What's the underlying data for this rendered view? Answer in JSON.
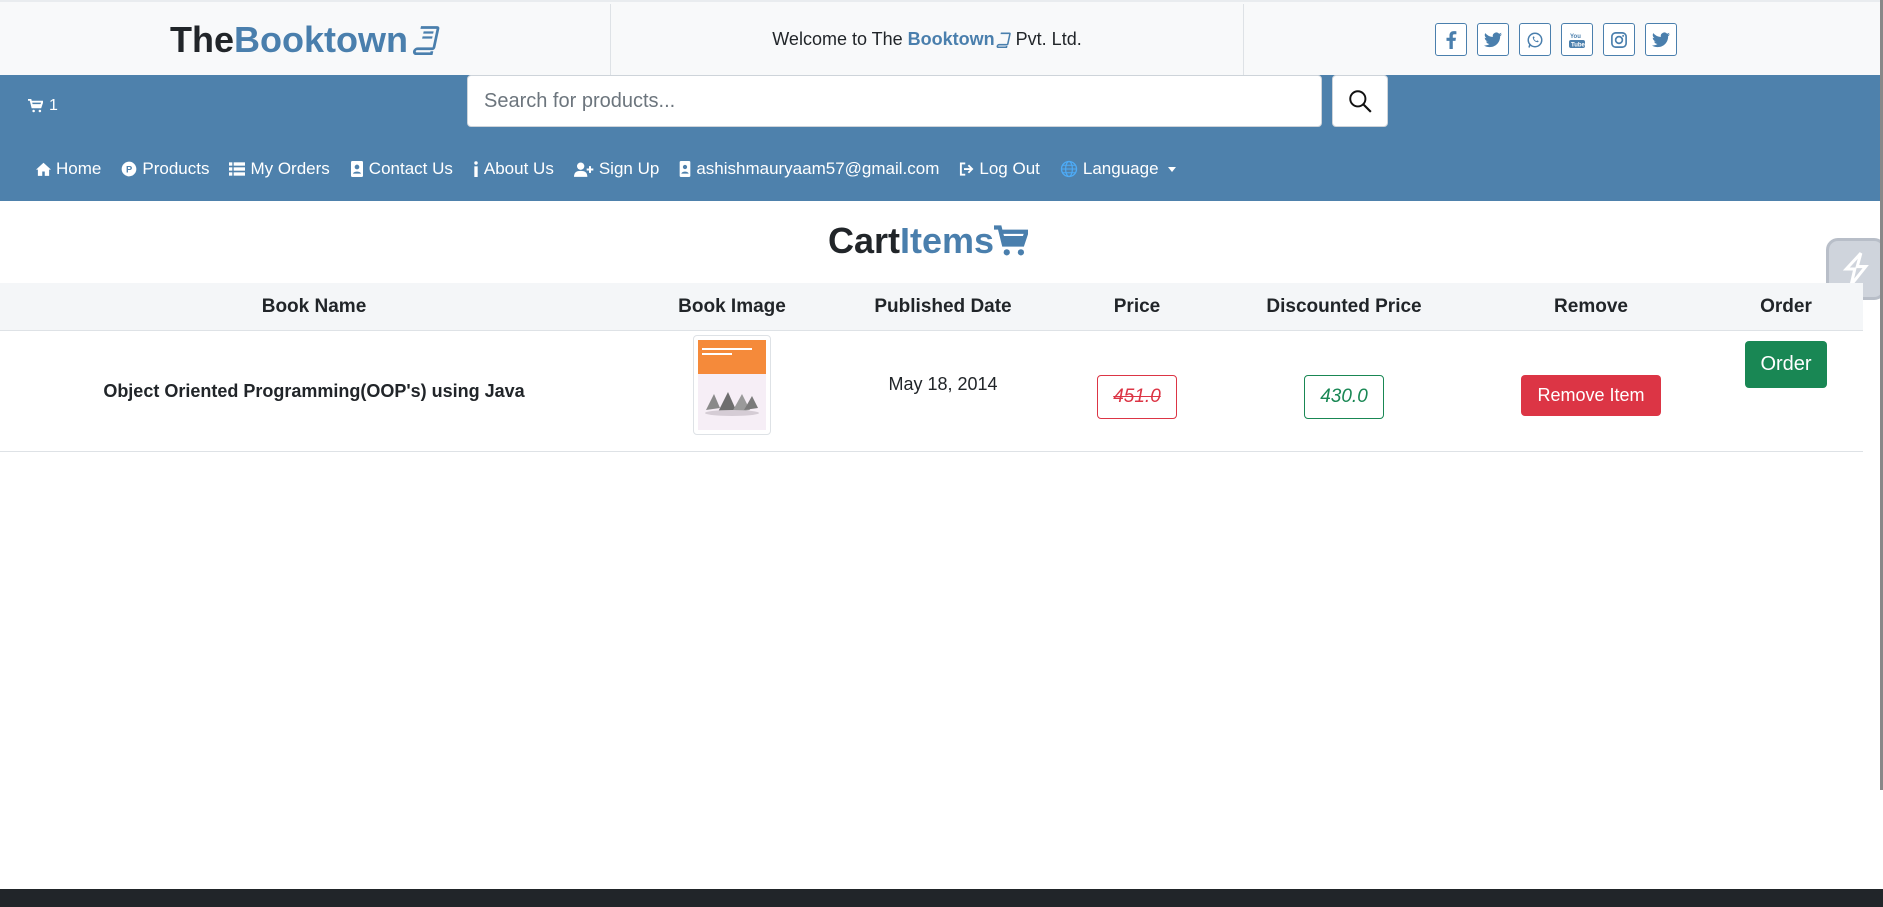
{
  "brand": {
    "logo_part1": "The",
    "logo_part2": "Booktown",
    "welcome_prefix": "Welcome to The",
    "welcome_brand": "Booktown",
    "welcome_suffix": "Pvt. Ltd."
  },
  "social": [
    "facebook-icon",
    "twitter-icon",
    "whatsapp-icon",
    "youtube-icon",
    "instagram-icon",
    "twitter-icon"
  ],
  "header": {
    "cart_count": "1",
    "search_placeholder": "Search for products..."
  },
  "nav": {
    "home": "Home",
    "products": "Products",
    "my_orders": "My Orders",
    "contact_us": "Contact Us",
    "about_us": "About Us",
    "sign_up": "Sign Up",
    "email": "ashishmauryaam57@gmail.com",
    "log_out": "Log Out",
    "language": "Language"
  },
  "page": {
    "title_part1": "Cart",
    "title_part2": "Items"
  },
  "table": {
    "headers": {
      "book_name": "Book Name",
      "book_image": "Book Image",
      "published_date": "Published Date",
      "price": "Price",
      "discounted_price": "Discounted Price",
      "remove": "Remove",
      "order": "Order"
    },
    "rows": [
      {
        "book_name": "Object Oriented Programming(OOP's) using Java",
        "published_date": "May 18, 2014",
        "price": "451.0",
        "discounted_price": "430.0",
        "remove_label": "Remove Item",
        "order_label": "Order"
      }
    ]
  },
  "colors": {
    "brand_blue": "#4e81ac",
    "danger": "#dc3545",
    "success": "#198754"
  }
}
